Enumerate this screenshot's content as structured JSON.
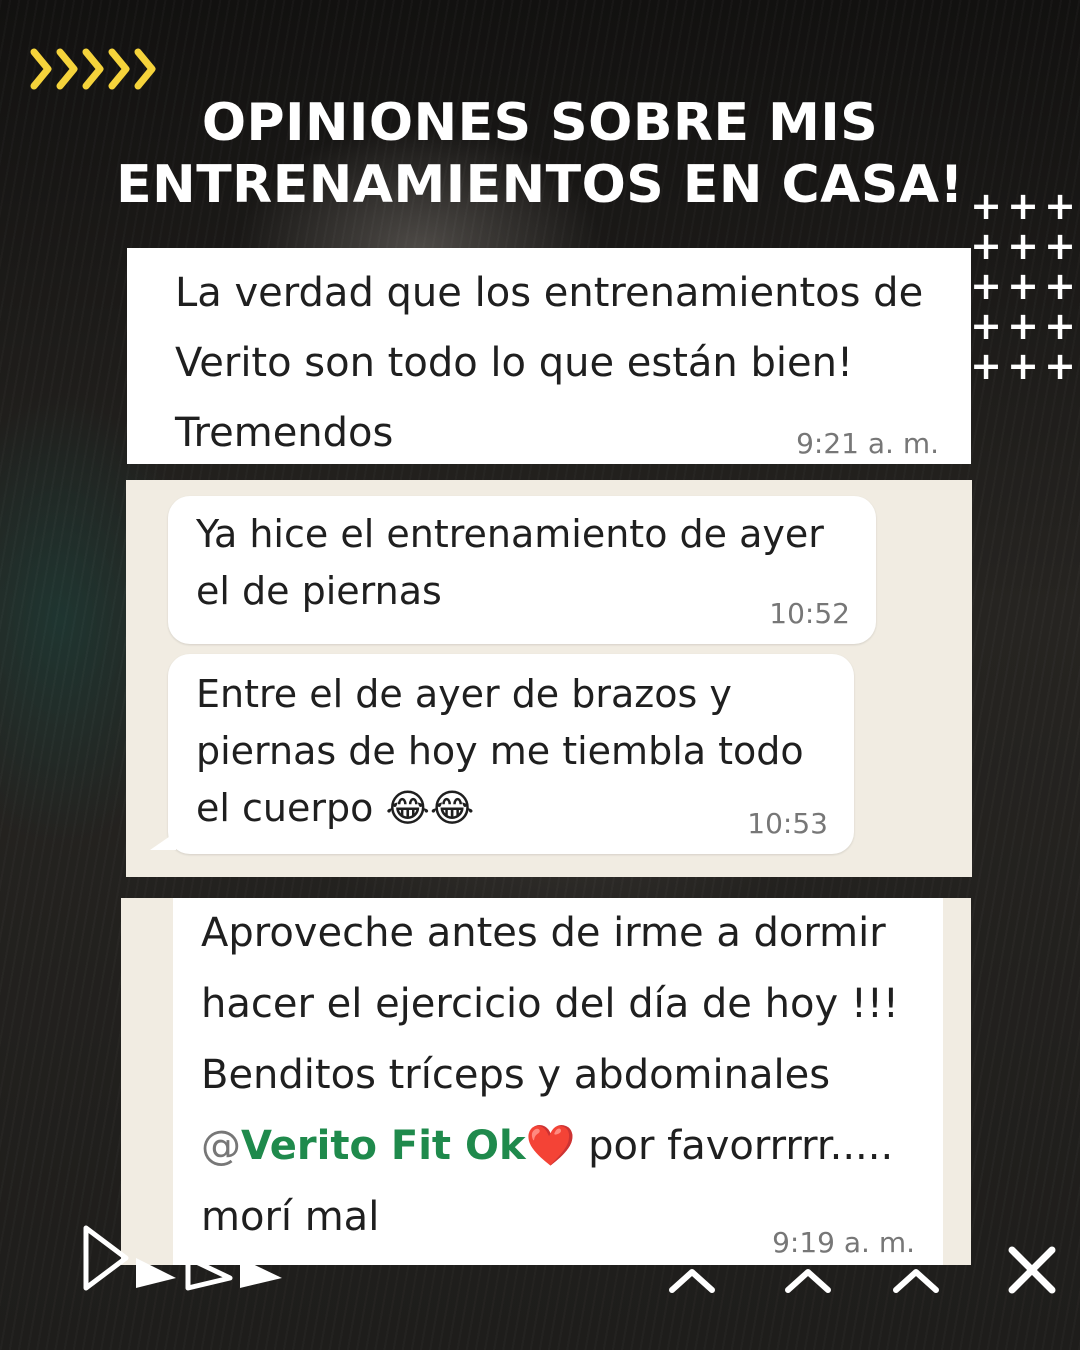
{
  "title": {
    "line1": "OPINIONES SOBRE MIS",
    "line2": "ENTRENAMIENTOS EN CASA!"
  },
  "colors": {
    "accent_arrows": "#f5d33b",
    "mention_green": "#1f8a4c",
    "heart_red": "#d21f1f",
    "chat_bg": "#f1ece2"
  },
  "decor": {
    "top_arrows_icon": "five-chevrons-right-icon",
    "plus_grid_icon": "plus-icon",
    "bottom_left_icon": "play-triangles-icon",
    "bottom_right_icons": [
      "chevron-up-icon",
      "close-icon"
    ]
  },
  "testimonials": [
    {
      "text": "La verdad que los entrenamientos de Verito son todo lo que están bien! Tremendos",
      "time": "9:21 a. m."
    },
    {
      "messages": [
        {
          "text": "Ya hice el entrenamiento de ayer el de piernas",
          "time": "10:52"
        },
        {
          "text": "Entre el de ayer de brazos y piernas de hoy me tiembla todo el cuerpo",
          "emoji": "😂😂",
          "time": "10:53"
        }
      ]
    },
    {
      "text_before_mention": "Aproveche antes de irme a dormir hacer el ejercicio del día de hoy !!! Benditos tríceps y abdominales",
      "mention_at": "@",
      "mention_name": "Verito Fit Ok",
      "heart": "❤️",
      "text_after_mention": "por favorrrrr..... morí mal",
      "time": "9:19 a. m."
    }
  ]
}
